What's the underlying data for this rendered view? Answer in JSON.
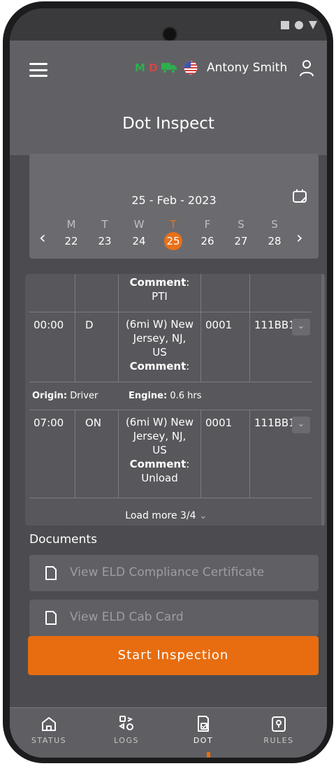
{
  "header": {
    "md_letters": [
      "M",
      "D"
    ],
    "user_name": "Antony Smith",
    "page_title": "Dot Inspect"
  },
  "calendar": {
    "date": "25 - Feb - 2023",
    "days": [
      {
        "label": "M",
        "num": "22",
        "active": false
      },
      {
        "label": "T",
        "num": "23",
        "active": false
      },
      {
        "label": "W",
        "num": "24",
        "active": false
      },
      {
        "label": "T",
        "num": "25",
        "active": true
      },
      {
        "label": "F",
        "num": "26",
        "active": false
      },
      {
        "label": "S",
        "num": "27",
        "active": false
      },
      {
        "label": "S",
        "num": "28",
        "active": false
      }
    ],
    "accent": "#e8701a"
  },
  "logs": {
    "top_comment_label": "Comment",
    "top_comment_value": "PTI",
    "rows": [
      {
        "time": "00:00",
        "status": "D",
        "location_lines": [
          "(6mi W) New",
          "Jersey, NJ,",
          "US"
        ],
        "comment_label": "Comment",
        "comment": "",
        "odometer": "0001",
        "vehicle": "111BB1"
      },
      {
        "time": "07:00",
        "status": "ON",
        "location_lines": [
          "(6mi W) New",
          "Jersey, NJ,",
          "US"
        ],
        "comment_label": "Comment",
        "comment": "Unload",
        "odometer": "0001",
        "vehicle": "111BB1"
      }
    ],
    "meta": {
      "origin_label": "Origin:",
      "origin_value": "Driver",
      "engine_label": "Engine:",
      "engine_value": "0.6 hrs"
    },
    "load_more": "Load more 3/4"
  },
  "documents": {
    "title": "Documents",
    "items": [
      {
        "label": "View ELD Compliance Certificate",
        "icon": "document-icon"
      },
      {
        "label": "View ELD Cab Card",
        "icon": "document-icon"
      }
    ]
  },
  "start_button": "Start Inspection",
  "nav": [
    {
      "label": "STATUS",
      "icon": "home-icon",
      "active": false
    },
    {
      "label": "LOGS",
      "icon": "logs-icon",
      "active": false
    },
    {
      "label": "DOT",
      "icon": "dot-icon",
      "active": true
    },
    {
      "label": "RULES",
      "icon": "rules-icon",
      "active": false
    }
  ],
  "colors": {
    "primary": "#e76d10",
    "background": "#4c4c50",
    "header": "#616165"
  }
}
